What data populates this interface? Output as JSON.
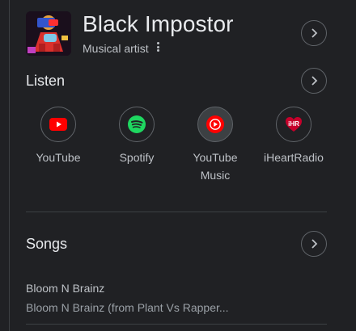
{
  "entity": {
    "title": "Black Impostor",
    "subtitle": "Musical artist"
  },
  "listen": {
    "heading": "Listen",
    "providers": [
      {
        "label": "YouTube",
        "icon": "youtube-icon",
        "color": "#ff0000"
      },
      {
        "label": "Spotify",
        "icon": "spotify-icon",
        "color": "#1ed760"
      },
      {
        "label": "YouTube Music",
        "icon": "youtube-music-icon",
        "color": "#ff0000"
      },
      {
        "label": "iHeartRadio",
        "icon": "iheartradio-icon",
        "color": "#c6002b"
      }
    ]
  },
  "songs": {
    "heading": "Songs",
    "items": [
      {
        "title": "Bloom N Brainz",
        "album": "Bloom N Brainz (from Plant Vs Rapper..."
      }
    ]
  },
  "colors": {
    "background": "#202124",
    "text_primary": "#e8eaed",
    "text_secondary": "#bdc1c6",
    "border": "#5f6368"
  }
}
